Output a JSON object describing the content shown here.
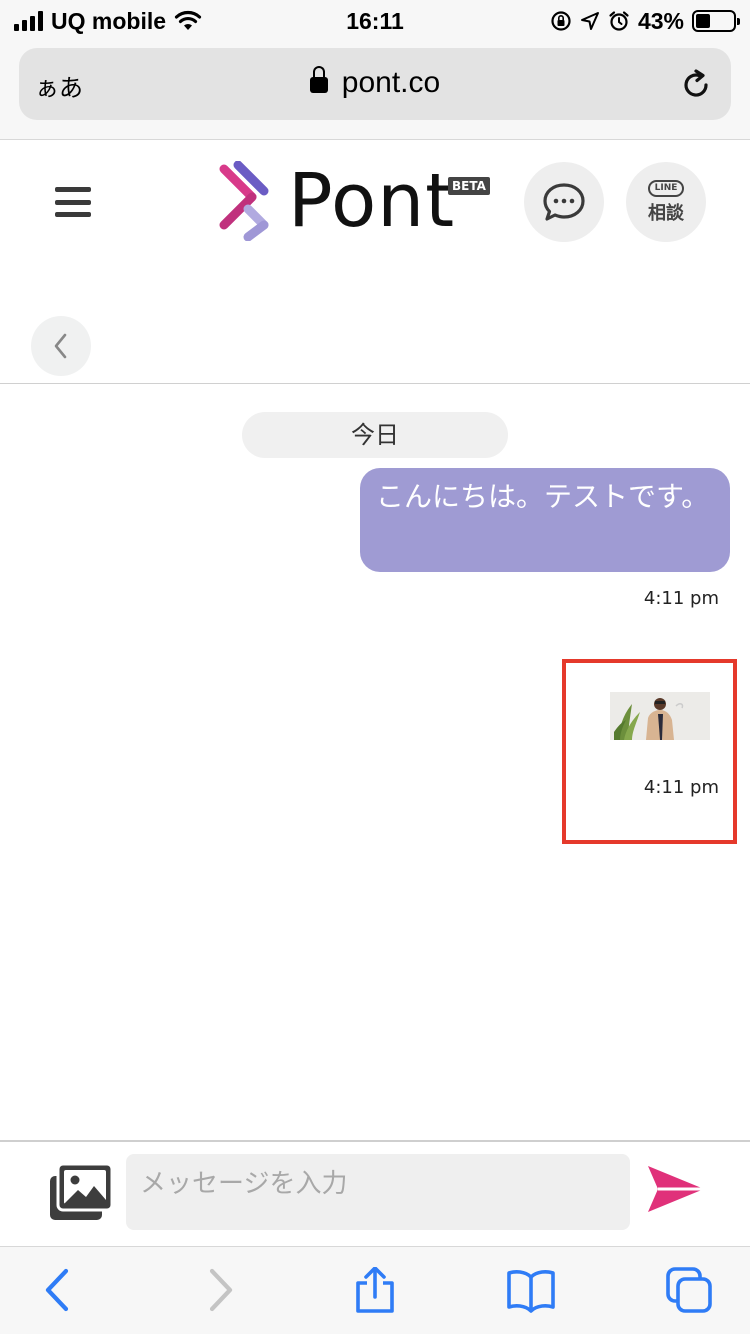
{
  "status_bar": {
    "carrier": "UQ mobile",
    "time": "16:11",
    "battery_percent": "43%",
    "battery_level": 0.43
  },
  "browser": {
    "text_size_label": "ぁあ",
    "url": "pont.co"
  },
  "header": {
    "logo_text": "Pont",
    "beta_badge": "BETA",
    "line_badge": "LINE",
    "line_label": "相談"
  },
  "chat": {
    "date_label": "今日",
    "messages": [
      {
        "text": "こんにちは。テストです。",
        "time": "4:11 pm"
      },
      {
        "type": "image",
        "time": "4:11 pm"
      }
    ]
  },
  "composer": {
    "placeholder": "メッセージを入力"
  },
  "colors": {
    "bubble": "#9f9bd3",
    "highlight": "#e5392b",
    "send": "#e0317a",
    "safari_accent": "#2f7cf6"
  }
}
